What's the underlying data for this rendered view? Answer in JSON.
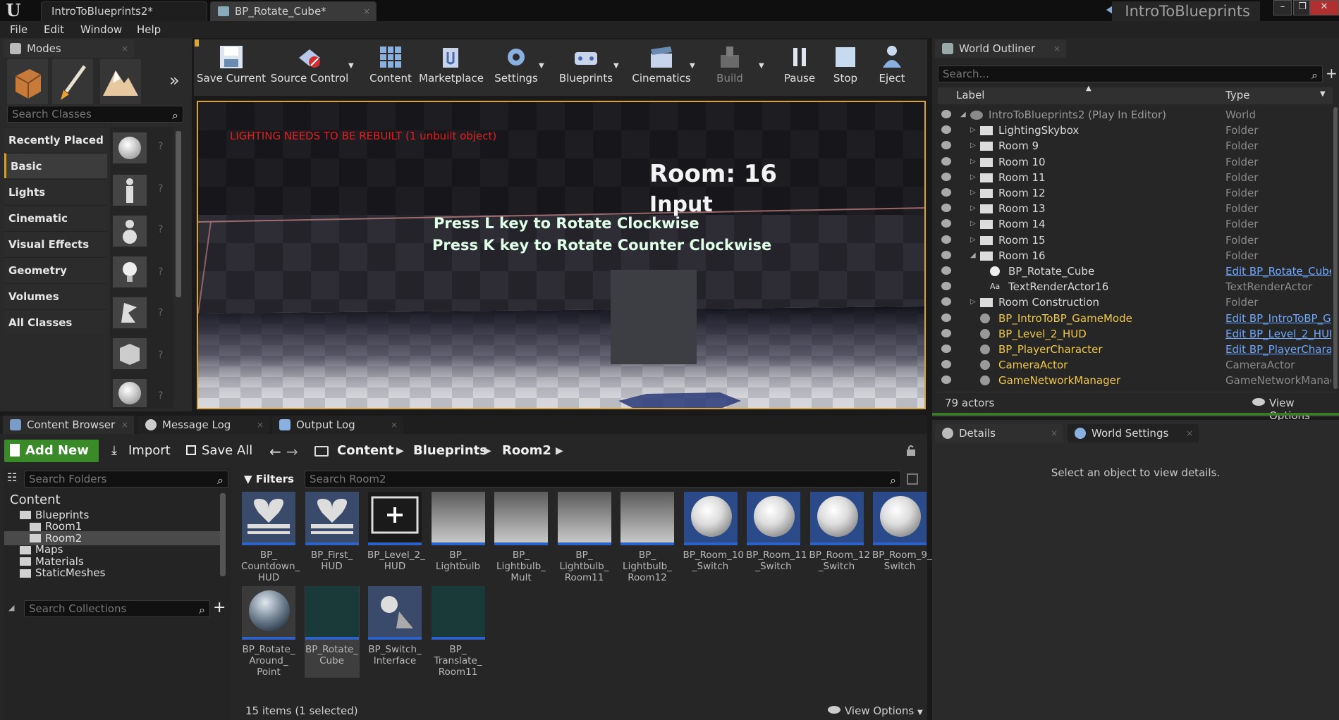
{
  "window": {
    "logo": "U",
    "tabs": [
      "IntroToBlueprints2*",
      "BP_Rotate_Cube*"
    ],
    "project_name": "IntroToBlueprints",
    "controls": [
      "–",
      "❐",
      "✕"
    ]
  },
  "menu": [
    "File",
    "Edit",
    "Window",
    "Help"
  ],
  "modes": {
    "tab_label": "Modes",
    "search_placeholder": "Search Classes",
    "categories": [
      "Recently Placed",
      "Basic",
      "Lights",
      "Cinematic",
      "Visual Effects",
      "Geometry",
      "Volumes",
      "All Classes"
    ],
    "selected_category": "Basic"
  },
  "toolbar": {
    "buttons": [
      "Save Current",
      "Source Control",
      "Content",
      "Marketplace",
      "Settings",
      "Blueprints",
      "Cinematics",
      "Build",
      "Pause",
      "Stop",
      "Eject"
    ]
  },
  "viewport": {
    "warning": "LIGHTING NEEDS TO BE REBUILT (1 unbuilt object)",
    "room_title": "Room: 16",
    "input_label": "Input",
    "instruction_1": "Press L key to Rotate Clockwise",
    "instruction_2": "Press K key to Rotate Counter Clockwise"
  },
  "outliner": {
    "tab_label": "World Outliner",
    "search_placeholder": "Search...",
    "col_label": "Label",
    "col_type": "Type",
    "rows": [
      {
        "label": "IntroToBlueprints2 (Play In Editor)",
        "type": "World",
        "indent": 0,
        "kind": "world"
      },
      {
        "label": "LightingSkybox",
        "type": "Folder",
        "indent": 1,
        "kind": "folder"
      },
      {
        "label": "Room 9",
        "type": "Folder",
        "indent": 1,
        "kind": "folder"
      },
      {
        "label": "Room 10",
        "type": "Folder",
        "indent": 1,
        "kind": "folder"
      },
      {
        "label": "Room 11",
        "type": "Folder",
        "indent": 1,
        "kind": "folder"
      },
      {
        "label": "Room 12",
        "type": "Folder",
        "indent": 1,
        "kind": "folder"
      },
      {
        "label": "Room 13",
        "type": "Folder",
        "indent": 1,
        "kind": "folder"
      },
      {
        "label": "Room 14",
        "type": "Folder",
        "indent": 1,
        "kind": "folder"
      },
      {
        "label": "Room 15",
        "type": "Folder",
        "indent": 1,
        "kind": "folder"
      },
      {
        "label": "Room 16",
        "type": "Folder",
        "indent": 1,
        "kind": "folder-open"
      },
      {
        "label": "BP_Rotate_Cube",
        "type": "Edit BP_Rotate_Cube",
        "indent": 2,
        "kind": "actor",
        "link": true
      },
      {
        "label": "TextRenderActor16",
        "type": "TextRenderActor",
        "indent": 2,
        "kind": "text"
      },
      {
        "label": "Room Construction",
        "type": "Folder",
        "indent": 1,
        "kind": "folder"
      },
      {
        "label": "BP_IntroToBP_GameMode",
        "type": "Edit BP_IntroToBP_G",
        "indent": 1,
        "kind": "actor-y",
        "link": true
      },
      {
        "label": "BP_Level_2_HUD",
        "type": "Edit BP_Level_2_HUD",
        "indent": 1,
        "kind": "actor-y",
        "link": true
      },
      {
        "label": "BP_PlayerCharacter",
        "type": "Edit BP_PlayerChara",
        "indent": 1,
        "kind": "actor-y",
        "link": true
      },
      {
        "label": "CameraActor",
        "type": "CameraActor",
        "indent": 1,
        "kind": "actor-y"
      },
      {
        "label": "GameNetworkManager",
        "type": "GameNetworkManage",
        "indent": 1,
        "kind": "actor-y"
      }
    ],
    "actor_count": "79 actors",
    "view_options": "View Options"
  },
  "details": {
    "tab_details": "Details",
    "tab_world_settings": "World Settings",
    "empty_message": "Select an object to view details."
  },
  "bottom_tabs": [
    "Content Browser",
    "Message Log",
    "Output Log"
  ],
  "content_browser": {
    "add_new": "Add New",
    "import": "Import",
    "save_all": "Save All",
    "breadcrumb": [
      "Content",
      "Blueprints",
      "Room2"
    ],
    "search_folders_placeholder": "Search Folders",
    "filters_label": "Filters",
    "search_assets_placeholder": "Search Room2",
    "search_collections_placeholder": "Search Collections",
    "folders": [
      {
        "label": "Content",
        "indent": 0
      },
      {
        "label": "Blueprints",
        "indent": 1
      },
      {
        "label": "Room1",
        "indent": 2
      },
      {
        "label": "Room2",
        "indent": 2,
        "selected": true
      },
      {
        "label": "Maps",
        "indent": 1
      },
      {
        "label": "Materials",
        "indent": 1
      },
      {
        "label": "StaticMeshes",
        "indent": 1
      }
    ],
    "assets": [
      {
        "name": "BP_\nCountdown_\nHUD",
        "thumb": "hud"
      },
      {
        "name": "BP_First_\nHUD",
        "thumb": "hud"
      },
      {
        "name": "BP_Level_2_\nHUD",
        "thumb": "hud2"
      },
      {
        "name": "BP_\nLightbulb",
        "thumb": "grid"
      },
      {
        "name": "BP_\nLightbulb_\nMult",
        "thumb": "grid"
      },
      {
        "name": "BP_\nLightbulb_\nRoom11",
        "thumb": "grid"
      },
      {
        "name": "BP_\nLightbulb_\nRoom12",
        "thumb": "grid"
      },
      {
        "name": "BP_Room_10\n_Switch",
        "thumb": "sphere"
      },
      {
        "name": "BP_Room_11\n_Switch",
        "thumb": "sphere"
      },
      {
        "name": "BP_Room_12\n_Switch",
        "thumb": "sphere"
      },
      {
        "name": "BP_Room_9_\nSwitch",
        "thumb": "sphere"
      },
      {
        "name": "BP_Rotate_\nAround_\nPoint",
        "thumb": "chrome"
      },
      {
        "name": "BP_Rotate_\nCube",
        "thumb": "cube",
        "selected": true
      },
      {
        "name": "BP_Switch_\nInterface",
        "thumb": "iface"
      },
      {
        "name": "BP_\nTranslate_\nRoom11",
        "thumb": "cube"
      }
    ],
    "item_count": "15 items (1 selected)",
    "view_options": "View Options"
  }
}
